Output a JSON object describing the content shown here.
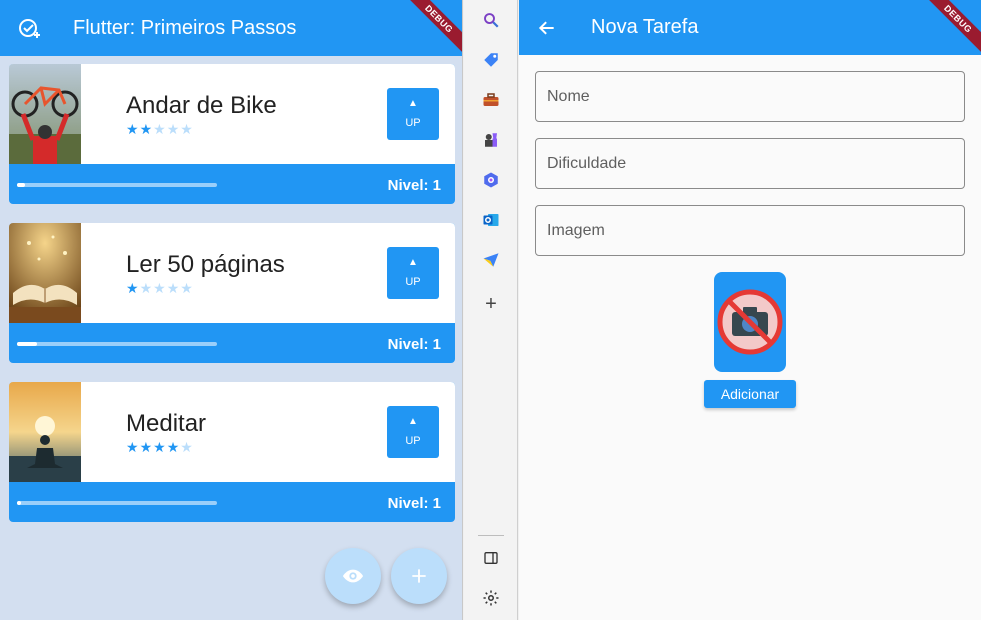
{
  "left_app": {
    "title": "Flutter: Primeiros Passos",
    "debug_label": "DEBUG",
    "tasks": [
      {
        "name": "Andar de Bike",
        "difficulty": 2,
        "up_label": "UP",
        "nivel": "Nivel: 1",
        "progress": 0.04
      },
      {
        "name": "Ler 50 páginas",
        "difficulty": 1,
        "up_label": "UP",
        "nivel": "Nivel: 1",
        "progress": 0.1
      },
      {
        "name": "Meditar",
        "difficulty": 4,
        "up_label": "UP",
        "nivel": "Nivel: 1",
        "progress": 0.02
      }
    ],
    "fabs": [
      "eye-icon",
      "plus-icon"
    ]
  },
  "toolbar": {
    "icons": [
      "search-icon",
      "tag-icon",
      "toolbox-icon",
      "chess-icon",
      "copilot-icon",
      "outlook-icon",
      "send-icon",
      "add-icon",
      "sidebar-icon",
      "settings-icon"
    ]
  },
  "right_app": {
    "title": "Nova Tarefa",
    "debug_label": "DEBUG",
    "fields": {
      "nome": {
        "placeholder": "Nome",
        "value": ""
      },
      "dificuldade": {
        "placeholder": "Dificuldade",
        "value": ""
      },
      "imagem": {
        "placeholder": "Imagem",
        "value": ""
      }
    },
    "add_label": "Adicionar"
  },
  "colors": {
    "primary": "#2196f3",
    "primary_light": "#bbdefb",
    "background_left": "#d3dff0",
    "debug_ribbon": "#9a1b2f"
  }
}
